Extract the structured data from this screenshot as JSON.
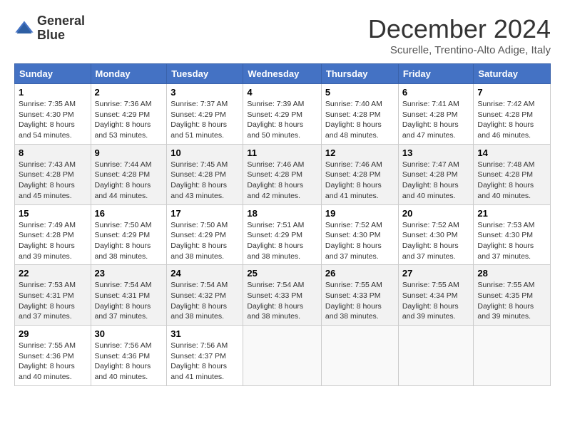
{
  "logo": {
    "line1": "General",
    "line2": "Blue"
  },
  "title": "December 2024",
  "subtitle": "Scurelle, Trentino-Alto Adige, Italy",
  "days_of_week": [
    "Sunday",
    "Monday",
    "Tuesday",
    "Wednesday",
    "Thursday",
    "Friday",
    "Saturday"
  ],
  "weeks": [
    [
      {
        "day": "1",
        "sunrise": "Sunrise: 7:35 AM",
        "sunset": "Sunset: 4:30 PM",
        "daylight": "Daylight: 8 hours and 54 minutes."
      },
      {
        "day": "2",
        "sunrise": "Sunrise: 7:36 AM",
        "sunset": "Sunset: 4:29 PM",
        "daylight": "Daylight: 8 hours and 53 minutes."
      },
      {
        "day": "3",
        "sunrise": "Sunrise: 7:37 AM",
        "sunset": "Sunset: 4:29 PM",
        "daylight": "Daylight: 8 hours and 51 minutes."
      },
      {
        "day": "4",
        "sunrise": "Sunrise: 7:39 AM",
        "sunset": "Sunset: 4:29 PM",
        "daylight": "Daylight: 8 hours and 50 minutes."
      },
      {
        "day": "5",
        "sunrise": "Sunrise: 7:40 AM",
        "sunset": "Sunset: 4:28 PM",
        "daylight": "Daylight: 8 hours and 48 minutes."
      },
      {
        "day": "6",
        "sunrise": "Sunrise: 7:41 AM",
        "sunset": "Sunset: 4:28 PM",
        "daylight": "Daylight: 8 hours and 47 minutes."
      },
      {
        "day": "7",
        "sunrise": "Sunrise: 7:42 AM",
        "sunset": "Sunset: 4:28 PM",
        "daylight": "Daylight: 8 hours and 46 minutes."
      }
    ],
    [
      {
        "day": "8",
        "sunrise": "Sunrise: 7:43 AM",
        "sunset": "Sunset: 4:28 PM",
        "daylight": "Daylight: 8 hours and 45 minutes."
      },
      {
        "day": "9",
        "sunrise": "Sunrise: 7:44 AM",
        "sunset": "Sunset: 4:28 PM",
        "daylight": "Daylight: 8 hours and 44 minutes."
      },
      {
        "day": "10",
        "sunrise": "Sunrise: 7:45 AM",
        "sunset": "Sunset: 4:28 PM",
        "daylight": "Daylight: 8 hours and 43 minutes."
      },
      {
        "day": "11",
        "sunrise": "Sunrise: 7:46 AM",
        "sunset": "Sunset: 4:28 PM",
        "daylight": "Daylight: 8 hours and 42 minutes."
      },
      {
        "day": "12",
        "sunrise": "Sunrise: 7:46 AM",
        "sunset": "Sunset: 4:28 PM",
        "daylight": "Daylight: 8 hours and 41 minutes."
      },
      {
        "day": "13",
        "sunrise": "Sunrise: 7:47 AM",
        "sunset": "Sunset: 4:28 PM",
        "daylight": "Daylight: 8 hours and 40 minutes."
      },
      {
        "day": "14",
        "sunrise": "Sunrise: 7:48 AM",
        "sunset": "Sunset: 4:28 PM",
        "daylight": "Daylight: 8 hours and 40 minutes."
      }
    ],
    [
      {
        "day": "15",
        "sunrise": "Sunrise: 7:49 AM",
        "sunset": "Sunset: 4:28 PM",
        "daylight": "Daylight: 8 hours and 39 minutes."
      },
      {
        "day": "16",
        "sunrise": "Sunrise: 7:50 AM",
        "sunset": "Sunset: 4:29 PM",
        "daylight": "Daylight: 8 hours and 38 minutes."
      },
      {
        "day": "17",
        "sunrise": "Sunrise: 7:50 AM",
        "sunset": "Sunset: 4:29 PM",
        "daylight": "Daylight: 8 hours and 38 minutes."
      },
      {
        "day": "18",
        "sunrise": "Sunrise: 7:51 AM",
        "sunset": "Sunset: 4:29 PM",
        "daylight": "Daylight: 8 hours and 38 minutes."
      },
      {
        "day": "19",
        "sunrise": "Sunrise: 7:52 AM",
        "sunset": "Sunset: 4:30 PM",
        "daylight": "Daylight: 8 hours and 37 minutes."
      },
      {
        "day": "20",
        "sunrise": "Sunrise: 7:52 AM",
        "sunset": "Sunset: 4:30 PM",
        "daylight": "Daylight: 8 hours and 37 minutes."
      },
      {
        "day": "21",
        "sunrise": "Sunrise: 7:53 AM",
        "sunset": "Sunset: 4:30 PM",
        "daylight": "Daylight: 8 hours and 37 minutes."
      }
    ],
    [
      {
        "day": "22",
        "sunrise": "Sunrise: 7:53 AM",
        "sunset": "Sunset: 4:31 PM",
        "daylight": "Daylight: 8 hours and 37 minutes."
      },
      {
        "day": "23",
        "sunrise": "Sunrise: 7:54 AM",
        "sunset": "Sunset: 4:31 PM",
        "daylight": "Daylight: 8 hours and 37 minutes."
      },
      {
        "day": "24",
        "sunrise": "Sunrise: 7:54 AM",
        "sunset": "Sunset: 4:32 PM",
        "daylight": "Daylight: 8 hours and 38 minutes."
      },
      {
        "day": "25",
        "sunrise": "Sunrise: 7:54 AM",
        "sunset": "Sunset: 4:33 PM",
        "daylight": "Daylight: 8 hours and 38 minutes."
      },
      {
        "day": "26",
        "sunrise": "Sunrise: 7:55 AM",
        "sunset": "Sunset: 4:33 PM",
        "daylight": "Daylight: 8 hours and 38 minutes."
      },
      {
        "day": "27",
        "sunrise": "Sunrise: 7:55 AM",
        "sunset": "Sunset: 4:34 PM",
        "daylight": "Daylight: 8 hours and 39 minutes."
      },
      {
        "day": "28",
        "sunrise": "Sunrise: 7:55 AM",
        "sunset": "Sunset: 4:35 PM",
        "daylight": "Daylight: 8 hours and 39 minutes."
      }
    ],
    [
      {
        "day": "29",
        "sunrise": "Sunrise: 7:55 AM",
        "sunset": "Sunset: 4:36 PM",
        "daylight": "Daylight: 8 hours and 40 minutes."
      },
      {
        "day": "30",
        "sunrise": "Sunrise: 7:56 AM",
        "sunset": "Sunset: 4:36 PM",
        "daylight": "Daylight: 8 hours and 40 minutes."
      },
      {
        "day": "31",
        "sunrise": "Sunrise: 7:56 AM",
        "sunset": "Sunset: 4:37 PM",
        "daylight": "Daylight: 8 hours and 41 minutes."
      },
      null,
      null,
      null,
      null
    ]
  ]
}
